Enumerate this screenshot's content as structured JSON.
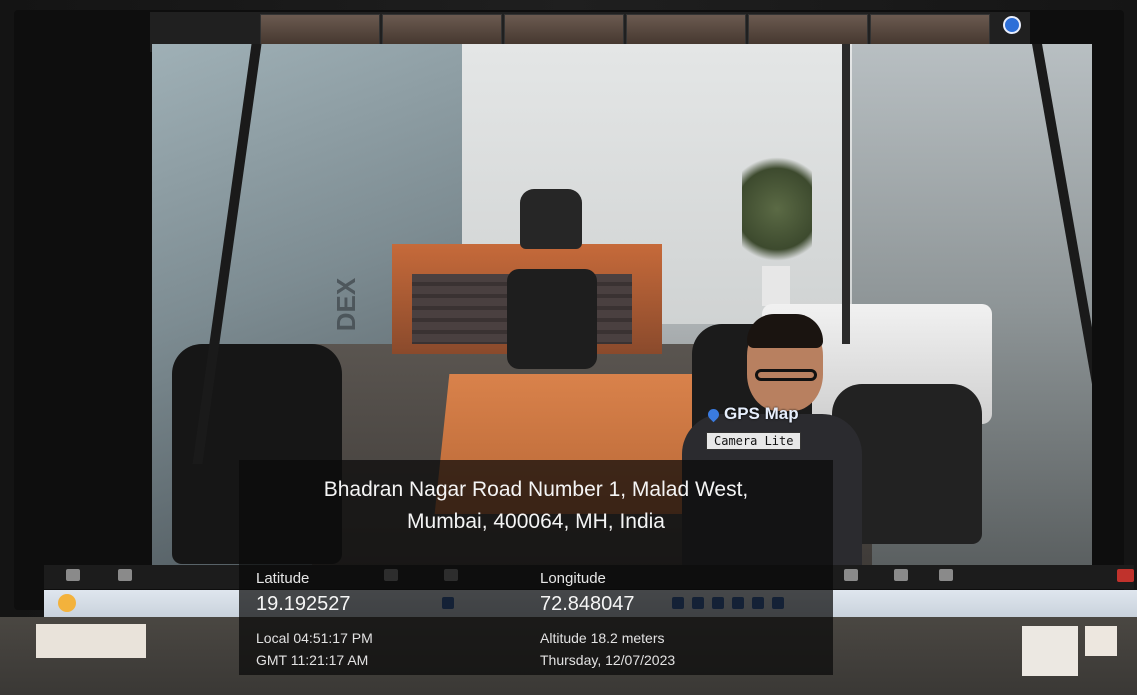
{
  "gps_overlay": {
    "app_logo": "GPS Map",
    "app_sub": "Camera Lite",
    "address_line1": "Bhadran Nagar Road Number 1, Malad West,",
    "address_line2": "Mumbai, 400064, MH, India",
    "latitude_label": "Latitude",
    "latitude_value": "19.192527",
    "longitude_label": "Longitude",
    "longitude_value": "72.848047",
    "local_time": "Local 04:51:17 PM",
    "gmt_time": "GMT 11:21:17 AM",
    "altitude": "Altitude 18.2 meters",
    "date": "Thursday, 12/07/2023"
  },
  "scene": {
    "glass_text": "DEX"
  },
  "colors": {
    "gps_pin": "#3a7be0",
    "zoom_badge": "#2d6fd8",
    "end_button": "#c0322c"
  },
  "icons": [
    "location-pin-icon",
    "zoom-badge-icon",
    "weather-icon",
    "end-meeting-icon"
  ]
}
